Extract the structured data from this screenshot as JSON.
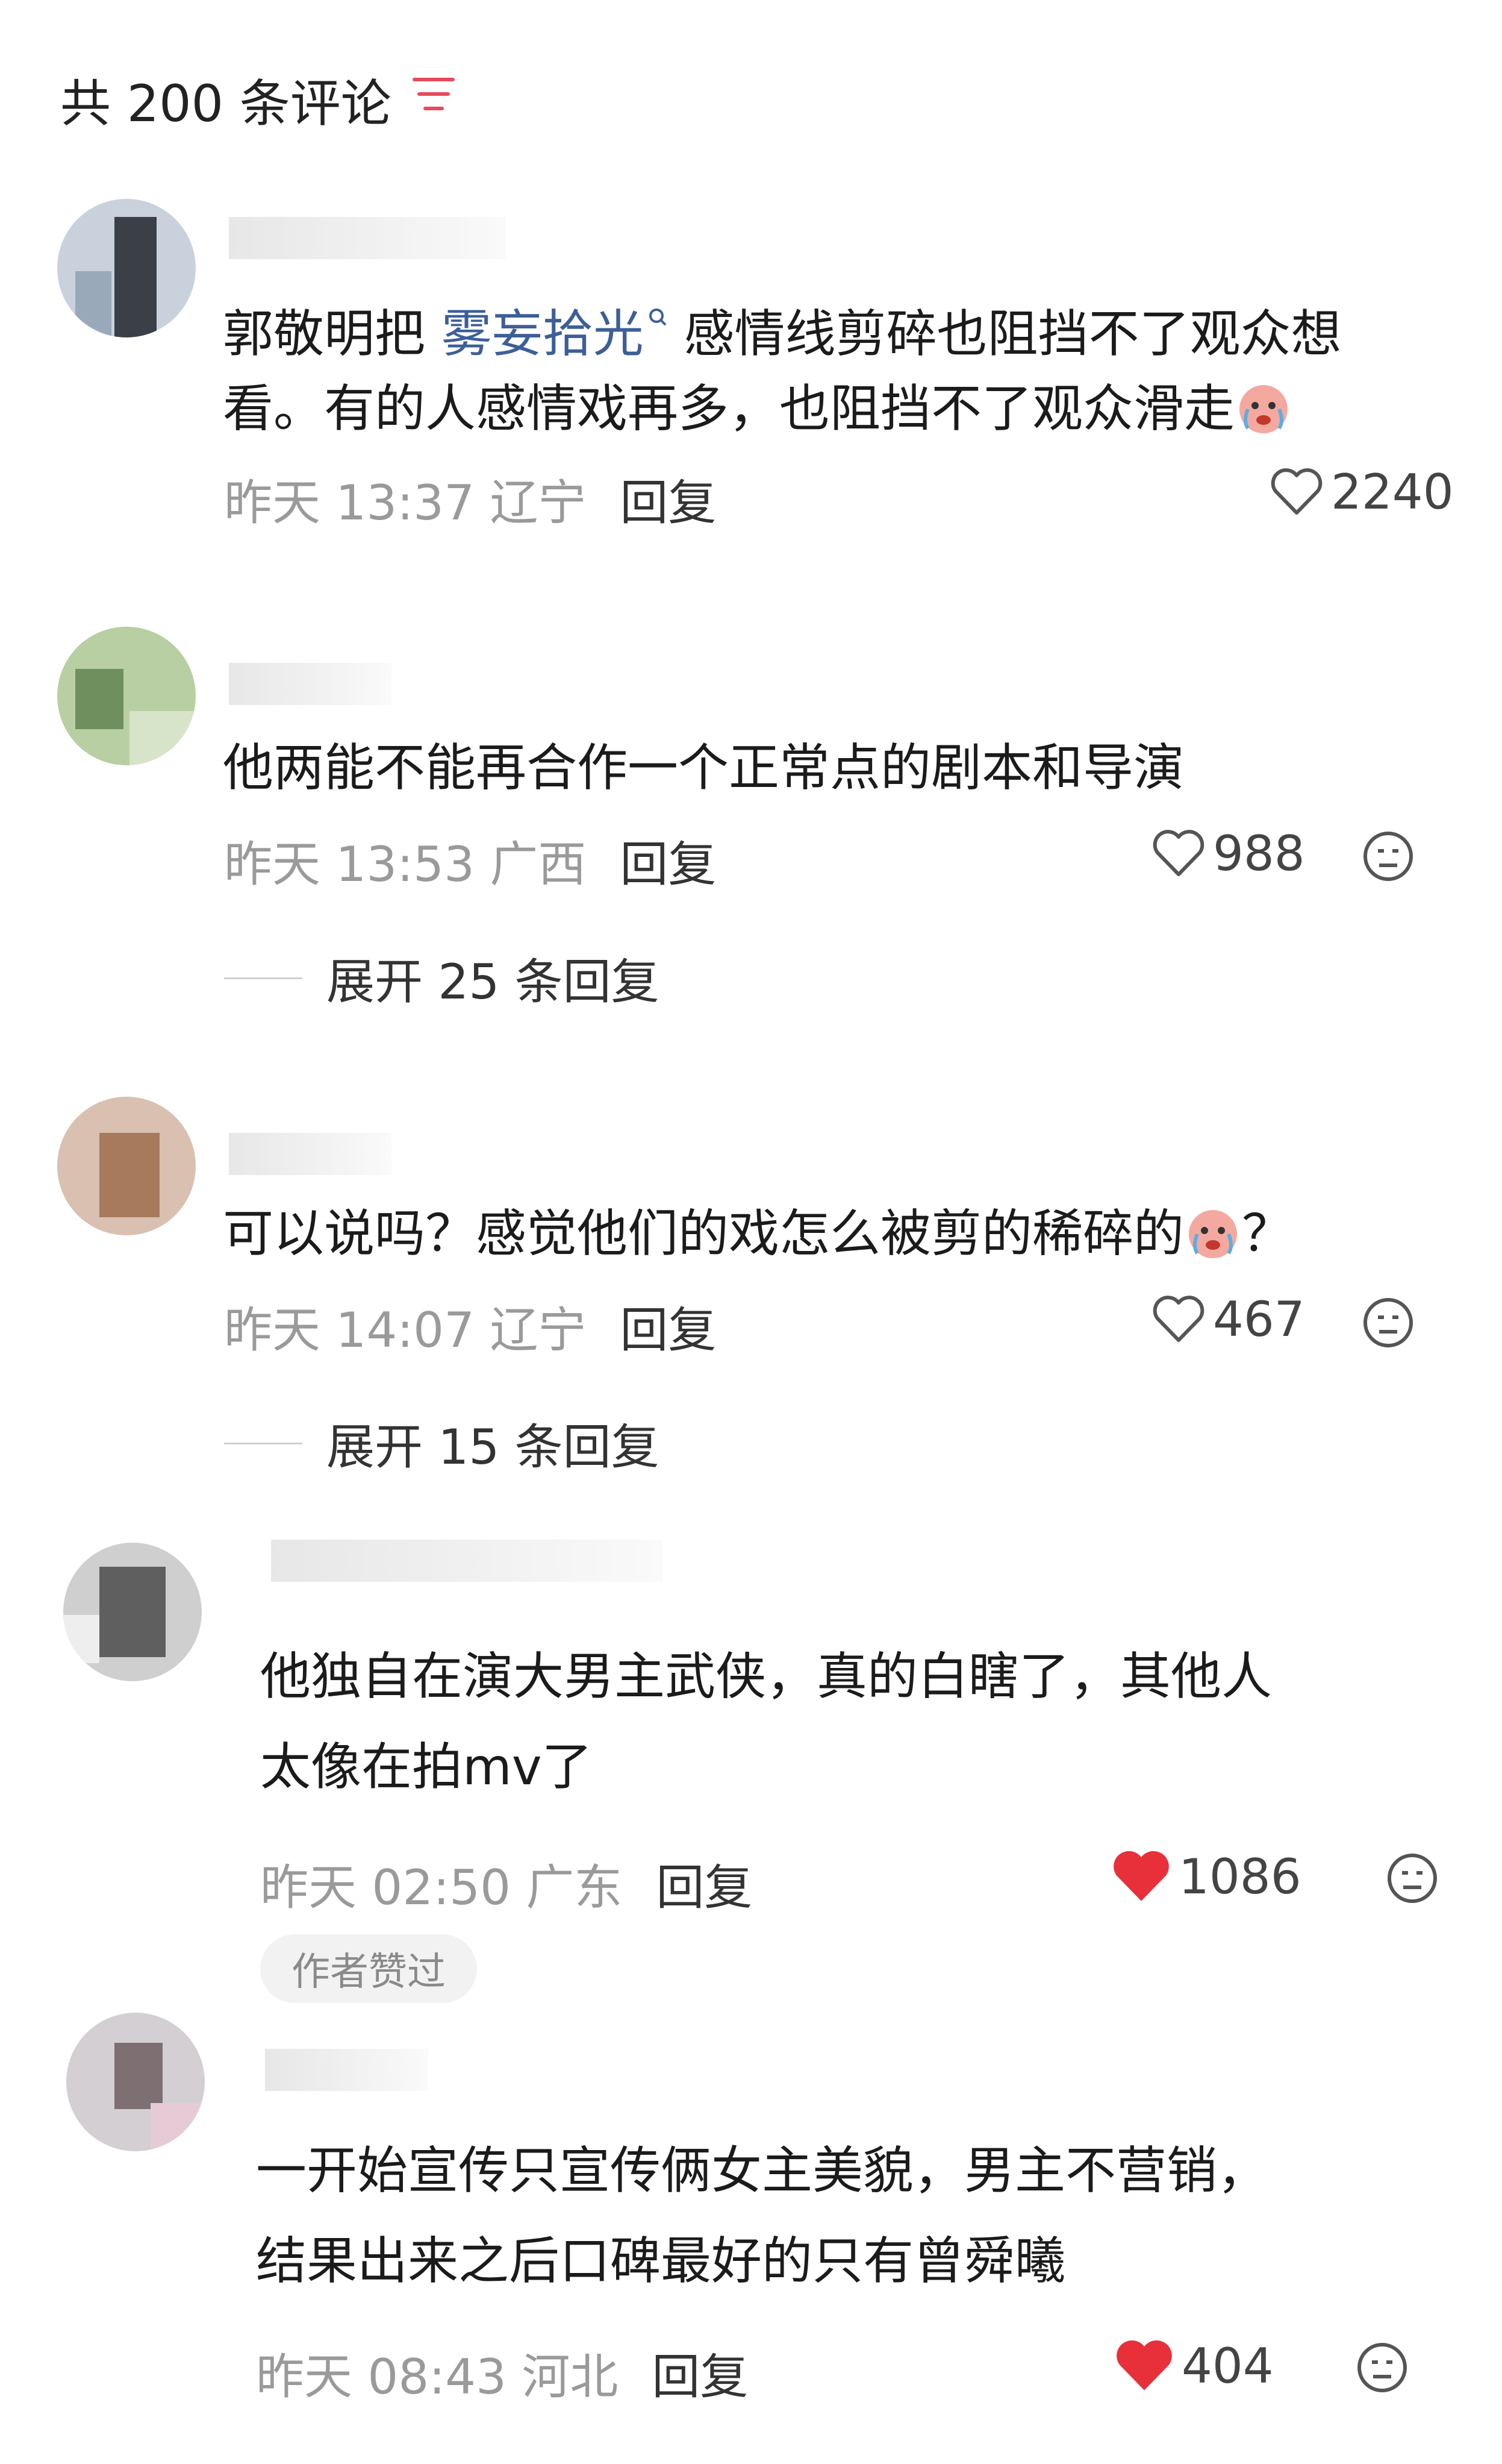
{
  "header": {
    "title": "共 200 条评论",
    "filter_icon": "filter-lines-icon"
  },
  "colors": {
    "link": "#3d5f98",
    "like_active": "#e8303b",
    "meta": "#9a9a9a"
  },
  "comments": [
    {
      "text_line1_pre": "郭敬明把",
      "link": "雾妄拾光",
      "text_line1_post": "感情线剪碎也阻挡不了观众想",
      "text_line2": "看。有的人感情戏再多，也阻挡不了观众滑走",
      "emoji": "crying-face-emoji",
      "time": "昨天 13:37",
      "location": "辽宁",
      "reply_label": "回复",
      "likes": "2240",
      "liked": false
    },
    {
      "text_line1": "他两能不能再合作一个正常点的剧本和导演",
      "time": "昨天 13:53",
      "location": "广西",
      "reply_label": "回复",
      "likes": "988",
      "liked": false,
      "expand_label": "展开 25 条回复"
    },
    {
      "text_line1_pre": "可以说吗？感觉他们的戏怎么被剪的稀碎的",
      "emoji": "crying-face-emoji",
      "text_line1_post": "？",
      "time": "昨天 14:07",
      "location": "辽宁",
      "reply_label": "回复",
      "likes": "467",
      "liked": false,
      "expand_label": "展开 15 条回复"
    },
    {
      "text_line1": "他独自在演大男主武侠，真的白瞎了，其他人",
      "text_line2": "太像在拍mv了",
      "time": "昨天 02:50",
      "location": "广东",
      "reply_label": "回复",
      "likes": "1086",
      "liked": true,
      "badge": "作者赞过"
    },
    {
      "text_line1": "一开始宣传只宣传俩女主美貌，男主不营销，",
      "text_line2": "结果出来之后口碑最好的只有曾舜曦",
      "time": "昨天 08:43",
      "location": "河北",
      "reply_label": "回复",
      "likes": "404",
      "liked": true
    }
  ]
}
